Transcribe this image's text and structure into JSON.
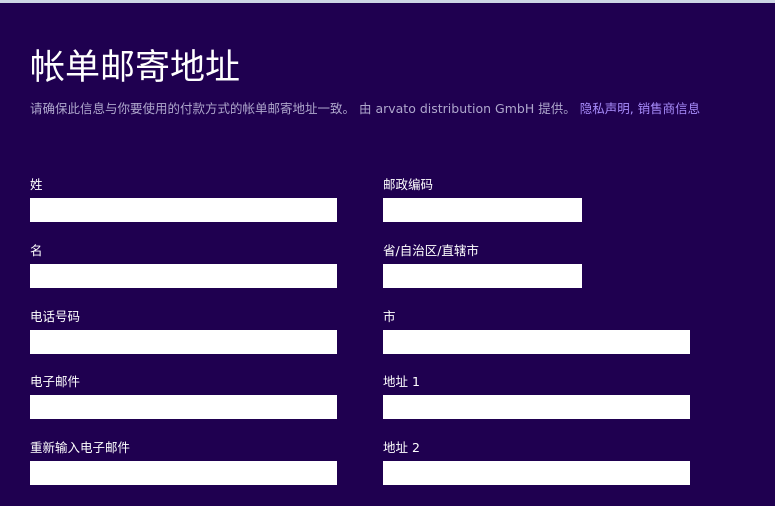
{
  "header": {
    "title": "帐单邮寄地址",
    "description": "请确保此信息与你要使用的付款方式的帐单邮寄地址一致。 由 arvato distribution GmbH 提供。",
    "links": [
      {
        "label": "隐私声明"
      },
      {
        "label": "销售商信息"
      }
    ],
    "link_separator": ", "
  },
  "form": {
    "left_column": [
      {
        "label": "姓",
        "value": ""
      },
      {
        "label": "名",
        "value": ""
      },
      {
        "label": "电话号码",
        "value": ""
      },
      {
        "label": "电子邮件",
        "value": ""
      },
      {
        "label": "重新输入电子邮件",
        "value": ""
      }
    ],
    "right_column": [
      {
        "label": "邮政编码",
        "value": ""
      },
      {
        "label": "省/自治区/直辖市",
        "value": ""
      },
      {
        "label": "市",
        "value": ""
      },
      {
        "label": "地址 1",
        "value": ""
      },
      {
        "label": "地址 2",
        "value": ""
      }
    ]
  },
  "colors": {
    "background": "#1f0050",
    "text": "#ffffff",
    "description": "#aea6cc",
    "link": "#a78bfa",
    "top_bar": "#cdd6e4",
    "input_background": "#ffffff"
  }
}
